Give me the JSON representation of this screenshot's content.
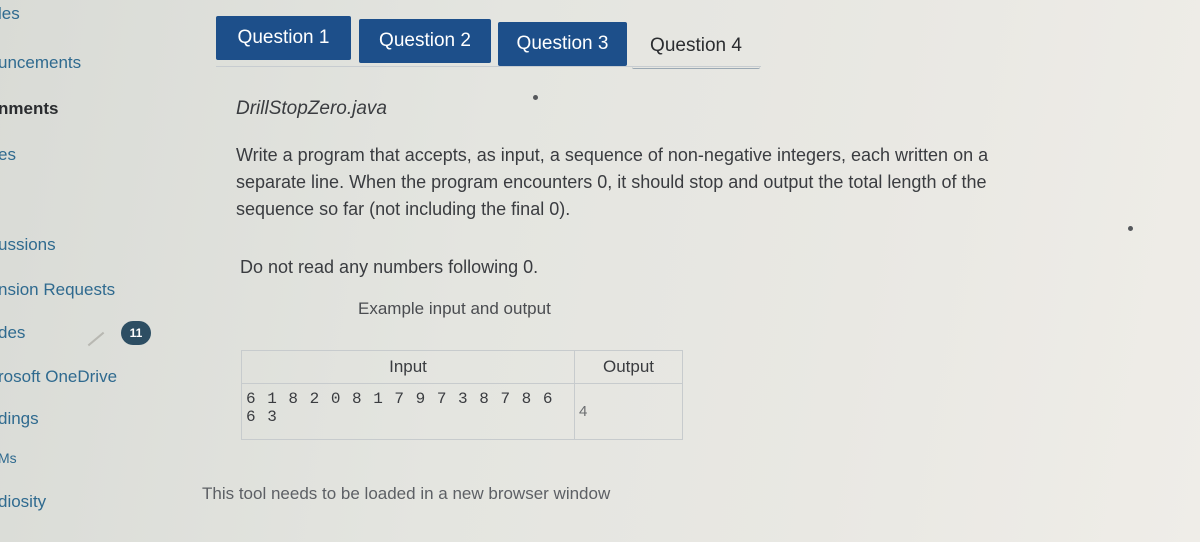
{
  "sidebar": {
    "items": [
      {
        "label": "les",
        "active": false
      },
      {
        "label": "uncements",
        "active": false
      },
      {
        "label": "nments",
        "active": true
      },
      {
        "label": "es",
        "active": false
      },
      {
        "label": "ussions",
        "active": false
      },
      {
        "label": "nsion Requests",
        "active": false
      },
      {
        "label": "des",
        "active": false,
        "badge": "11"
      },
      {
        "label": "rosoft OneDrive",
        "active": false
      },
      {
        "label": "dings",
        "active": false
      },
      {
        "label": "Ms",
        "active": false
      },
      {
        "label": "diosity",
        "active": false
      }
    ]
  },
  "tabs": [
    {
      "label": "Question 1",
      "selected": true
    },
    {
      "label": "Question 2",
      "selected": true
    },
    {
      "label": "Question 3",
      "selected": true
    },
    {
      "label": "Question 4",
      "selected": false
    }
  ],
  "question": {
    "file_name": "DrillStopZero.java",
    "description": "Write a program that accepts, as input, a sequence of non-negative integers, each written on a separate line. When the program encounters 0, it should stop and output the total length of the sequence so far (not including the final 0).",
    "note": "Do not read any numbers following 0.",
    "example_title": "Example input and output",
    "table": {
      "headers": [
        "Input",
        "Output"
      ],
      "rows": [
        {
          "input": "6 1 8 2 0 8 1 7 9 7 3 8 7 8 6 6 3",
          "output": "4"
        }
      ]
    }
  },
  "footer_note": "This tool needs to be loaded in a new browser window",
  "colors": {
    "tab_active": "#1d4f8a",
    "nav_link": "#2f6a8f",
    "badge": "#2d4e63"
  }
}
